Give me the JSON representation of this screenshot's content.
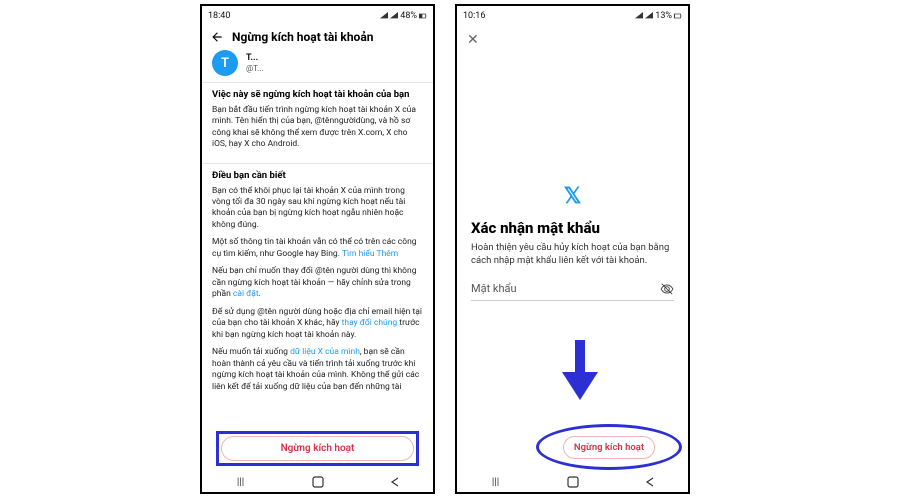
{
  "left": {
    "status": {
      "time": "18:40",
      "battery": "48%"
    },
    "header": {
      "title": "Ngừng kích hoạt tài khoản"
    },
    "account": {
      "initial": "T",
      "name": "T...",
      "handle": "@T..."
    },
    "section1": {
      "title": "Việc này sẽ ngừng kích hoạt tài khoản của bạn",
      "body": "Bạn bắt đầu tiến trình ngừng kích hoạt tài khoản X của mình. Tên hiển thị của bạn, @tênngườidùng, và hồ sơ công khai sẽ không thể xem được trên X.com, X cho iOS, hay X cho Android."
    },
    "section2": {
      "title": "Điều bạn cần biết",
      "p1": "Bạn có thể khôi phục lại tài khoản X của mình trong vòng tối đa 30 ngày sau khi ngừng kích hoạt nếu tài khoản của bạn bị ngừng kích hoạt ngẫu nhiên hoặc không đúng.",
      "p2a": "Một số thông tin tài khoản vẫn có thể có trên các công cụ tìm kiếm, như Google hay Bing. ",
      "p2link": "Tìm hiểu Thêm",
      "p3a": "Nếu bạn chỉ muốn thay đổi @tên người dùng thì không cần ngừng kích hoạt tài khoản — hãy chỉnh sửa trong phần ",
      "p3link": "cài đặt",
      "p3b": ".",
      "p4a": "Để sử dụng @tên người dùng hoặc địa chỉ email hiện tại của bạn cho tài khoản X khác, hãy ",
      "p4link": "thay đổi chúng",
      "p4b": " trước khi bạn ngừng kích hoạt tài khoản này.",
      "p5a": "Nếu muốn tải xuống ",
      "p5link": "dữ liệu X của mình",
      "p5b": ", bạn sẽ cần hoàn thành cả yêu cầu và tiến trình tải xuống trước khi ngừng kích hoạt tài khoản của mình. Không thể gửi các liên kết để tải xuống dữ liệu của bạn đến những tài"
    },
    "deact_button": "Ngừng kích hoạt"
  },
  "right": {
    "status": {
      "time": "10:16",
      "battery": "13%"
    },
    "logo": "𝕏",
    "title": "Xác nhận mật khẩu",
    "sub": "Hoàn thiện yêu cầu hủy kích hoạt của bạn bằng cách nhập mật khẩu liên kết với tài khoản.",
    "pw_label": "Mật khẩu",
    "deact_button": "Ngừng kích hoạt"
  }
}
